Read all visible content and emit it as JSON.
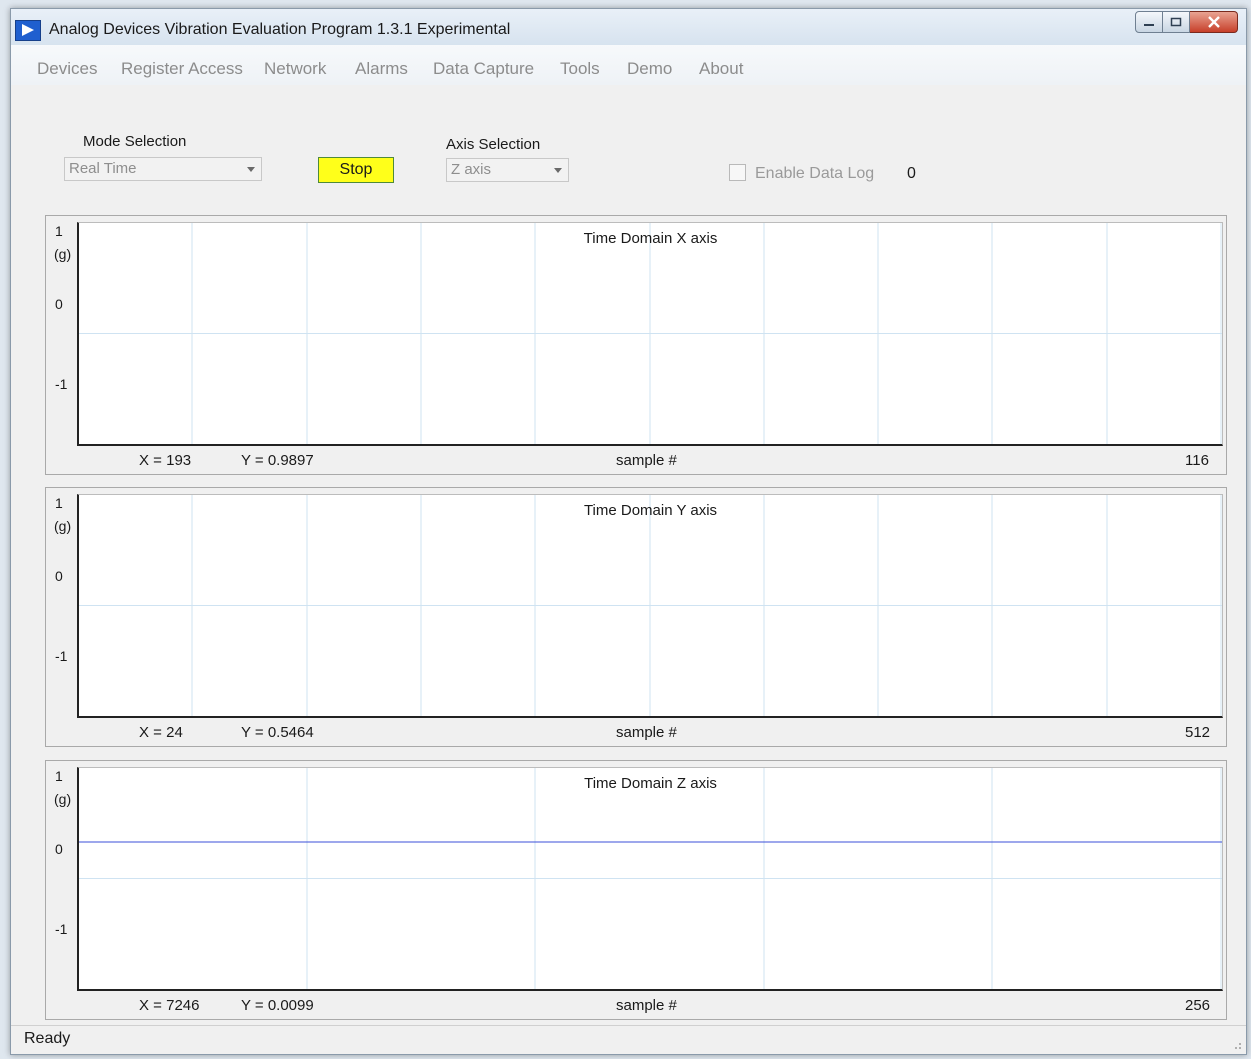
{
  "window": {
    "title": "Analog Devices Vibration Evaluation Program  1.3.1  Experimental",
    "icon": "analog-devices-logo-icon"
  },
  "menu": [
    "Devices",
    "Register Access",
    "Network",
    "Alarms",
    "Data Capture",
    "Tools",
    "Demo",
    "About"
  ],
  "controls": {
    "mode_label": "Mode Selection",
    "mode_value": "Real Time",
    "stop_label": "Stop",
    "axis_label": "Axis Selection",
    "axis_value": "Z axis",
    "datalog_label": "Enable Data Log",
    "datalog_count": "0"
  },
  "charts": [
    {
      "title": "Time Domain X axis",
      "yticks": [
        "1",
        "0",
        "-1"
      ],
      "yunit": "(g)",
      "x_readout": "X = 193",
      "y_readout": "Y = 0.9897",
      "xlabel": "sample #",
      "xmax_label": "116",
      "xmax": 116,
      "gridlines_x": 10,
      "series_value": null
    },
    {
      "title": "Time Domain Y axis",
      "yticks": [
        "1",
        "0",
        "-1"
      ],
      "yunit": "(g)",
      "x_readout": "X = 24",
      "y_readout": "Y = 0.5464",
      "xlabel": "sample #",
      "xmax_label": "512",
      "xmax": 512,
      "gridlines_x": 10,
      "series_value": null
    },
    {
      "title": "Time Domain Z axis",
      "yticks": [
        "1",
        "0",
        "-1"
      ],
      "yunit": "(g)",
      "x_readout": "X = 7246",
      "y_readout": "Y = 0.0099",
      "xlabel": "sample #",
      "xmax_label": "256",
      "xmax": 256,
      "gridlines_x": 5,
      "series_value": 0.5
    }
  ],
  "chart_data": [
    {
      "type": "line",
      "title": "Time Domain X axis",
      "xlabel": "sample #",
      "ylabel": "(g)",
      "ylim": [
        -1.5,
        1.5
      ],
      "xlim": [
        0,
        116
      ],
      "series": []
    },
    {
      "type": "line",
      "title": "Time Domain Y axis",
      "xlabel": "sample #",
      "ylabel": "(g)",
      "ylim": [
        -1.5,
        1.5
      ],
      "xlim": [
        0,
        512
      ],
      "series": []
    },
    {
      "type": "line",
      "title": "Time Domain Z axis",
      "xlabel": "sample #",
      "ylabel": "(g)",
      "ylim": [
        -1.5,
        1.5
      ],
      "xlim": [
        0,
        256
      ],
      "series": [
        {
          "x": [
            0,
            256
          ],
          "y": [
            0.5,
            0.5
          ]
        }
      ]
    }
  ],
  "colors": {
    "stop_button": "#ffff1a",
    "series_line": "#3b4fd8",
    "grid": "#cfe3f2"
  },
  "status": "Ready"
}
